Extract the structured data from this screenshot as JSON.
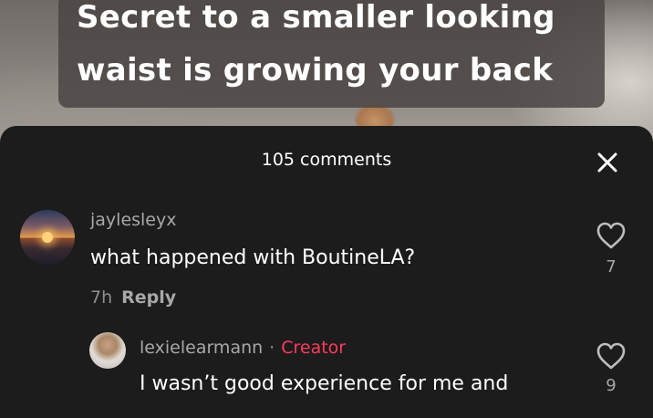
{
  "caption": {
    "line1": "Secret to a smaller looking",
    "line2": "waist is growing your back"
  },
  "comments_sheet": {
    "title": "105 comments",
    "close_icon": "close-x-icon"
  },
  "comments": [
    {
      "username": "jaylesleyx",
      "text": "what happened with BoutineLA?",
      "time": "7h",
      "reply_label": "Reply",
      "likes": "7",
      "avatar": "sunset-avatar"
    }
  ],
  "replies": [
    {
      "username": "lexielearmann",
      "separator": "·",
      "badge": "Creator",
      "text": "I wasn’t good experience for me and",
      "likes": "9",
      "avatar": "person-avatar"
    }
  ],
  "colors": {
    "sheet_bg": "#1c1c1c",
    "creator_badge": "#ff3b5c",
    "muted_text": "#a8a8a8"
  }
}
